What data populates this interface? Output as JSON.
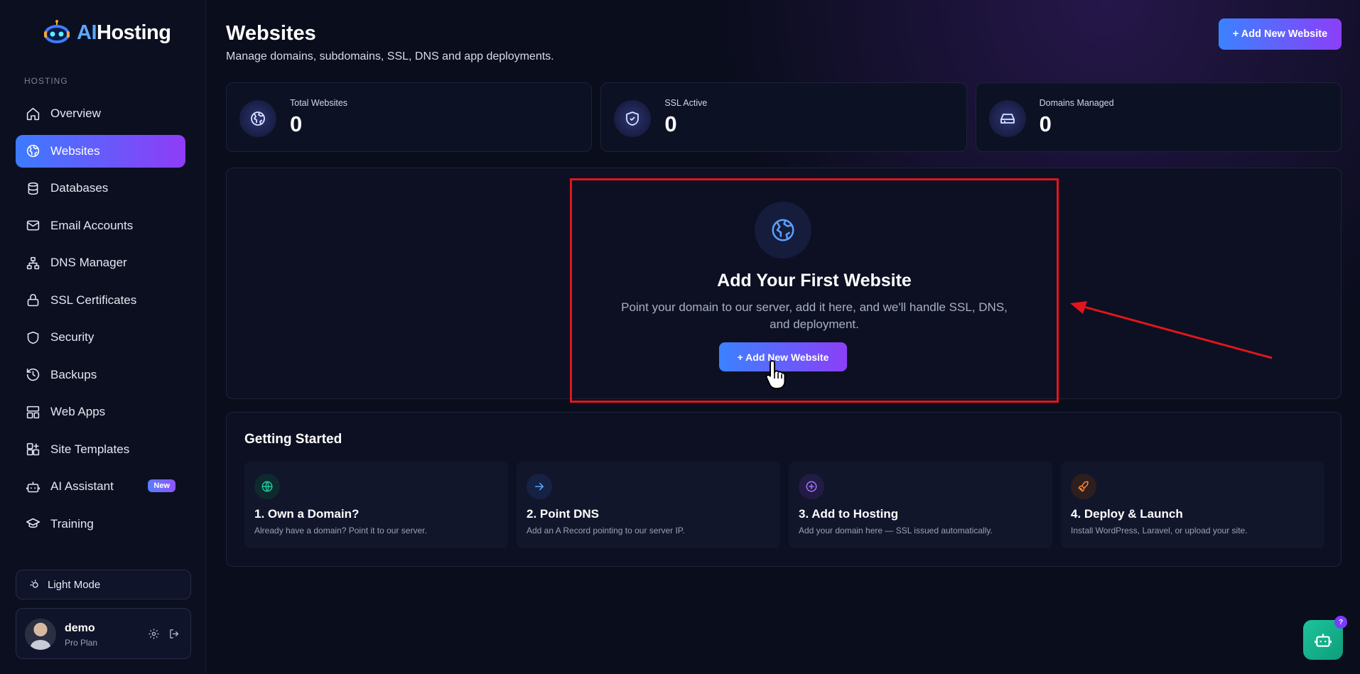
{
  "brand": {
    "prefix": "AI",
    "suffix": "Hosting"
  },
  "sidebar": {
    "section_label": "HOSTING",
    "items": [
      {
        "label": "Overview",
        "icon": "home-icon"
      },
      {
        "label": "Websites",
        "icon": "globe-icon",
        "active": true
      },
      {
        "label": "Databases",
        "icon": "database-icon"
      },
      {
        "label": "Email Accounts",
        "icon": "mail-icon"
      },
      {
        "label": "DNS Manager",
        "icon": "network-icon"
      },
      {
        "label": "SSL Certificates",
        "icon": "lock-icon"
      },
      {
        "label": "Security",
        "icon": "shield-icon"
      },
      {
        "label": "Backups",
        "icon": "history-icon"
      },
      {
        "label": "Web Apps",
        "icon": "layout-icon"
      },
      {
        "label": "Site Templates",
        "icon": "templates-icon"
      },
      {
        "label": "AI Assistant",
        "icon": "bot-icon",
        "badge": "New"
      },
      {
        "label": "Training",
        "icon": "graduation-cap-icon"
      }
    ],
    "mode_label": "Light Mode",
    "user": {
      "name": "demo",
      "plan": "Pro Plan"
    }
  },
  "header": {
    "title": "Websites",
    "subtitle": "Manage domains, subdomains, SSL, DNS and app deployments.",
    "primary_button": "+ Add New Website"
  },
  "stats": [
    {
      "label": "Total Websites",
      "value": "0",
      "icon": "globe-icon"
    },
    {
      "label": "SSL Active",
      "value": "0",
      "icon": "shield-check-icon"
    },
    {
      "label": "Domains Managed",
      "value": "0",
      "icon": "server-icon"
    }
  ],
  "empty_state": {
    "title": "Add Your First Website",
    "description": "Point your domain to our server, add it here, and we'll handle SSL, DNS, and deployment.",
    "button": "+ Add New Website"
  },
  "getting_started": {
    "title": "Getting Started",
    "steps": [
      {
        "title": "1. Own a Domain?",
        "desc": "Already have a domain? Point it to our server.",
        "icon": "globe-icon",
        "color": "#1fc7a0"
      },
      {
        "title": "2. Point DNS",
        "desc": "Add an A Record pointing to our server IP.",
        "icon": "arrow-right-icon",
        "color": "#5aa8ff"
      },
      {
        "title": "3. Add to Hosting",
        "desc": "Add your domain here — SSL issued automatically.",
        "icon": "plus-circle-icon",
        "color": "#a774ff"
      },
      {
        "title": "4. Deploy & Launch",
        "desc": "Install WordPress, Laravel, or upload your site.",
        "icon": "rocket-icon",
        "color": "#f08a3c"
      }
    ]
  },
  "chatbot": {
    "badge": "?"
  },
  "colors": {
    "accent_start": "#3b82ff",
    "accent_end": "#8b3ff8",
    "highlight": "#e0161c",
    "chatbot": "#1cc59b"
  }
}
